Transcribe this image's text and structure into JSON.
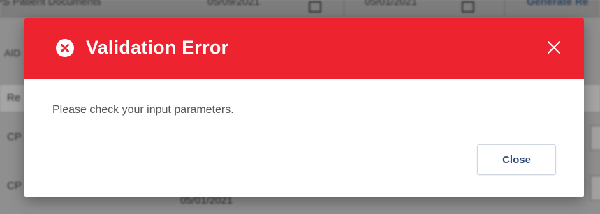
{
  "background": {
    "toolbar_fields": [
      "PS Patient Documents",
      "05/09/2021",
      "05/01/2021",
      "Generate Re"
    ],
    "row_labels": [
      "Re",
      "CP",
      "CP"
    ],
    "left_fragment": "AID",
    "bottom_date": "05/01/2021"
  },
  "dialog": {
    "title": "Validation Error",
    "message": "Please check your input parameters.",
    "close_label": "Close",
    "header_color": "#ee2330",
    "error_icon": "circle-x-icon",
    "dismiss_icon": "close-icon"
  }
}
